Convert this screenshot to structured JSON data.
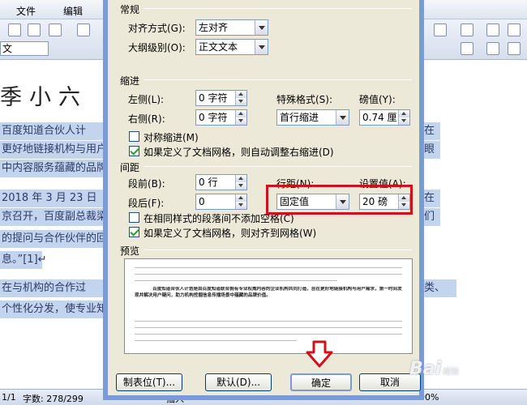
{
  "word": {
    "menus": [
      "文件",
      "编辑"
    ],
    "style_box": "文",
    "title_left": "季小六",
    "title_right": "季",
    "lines_left": [
      "    百度知道合伙人计",
      "更好地链接机构与用户",
      "中内容服务蕴藏的品牌",
      "    2018 年 3 月 23 日",
      "京召开，百度副总裁梁",
      "的提问与合作伙伴的回",
      "息。”[1]↵",
      "    在与机构的合作过",
      "个性化分发，使专业知"
    ],
    "lines_right": [
      "在",
      "眼",
      "在",
      "们",
      "类、"
    ],
    "status_text": {
      "page": "1/1",
      "words": "字数: 278/299",
      "mode": "插入",
      "zoom": "100%"
    }
  },
  "watermark": {
    "text": "Bai",
    "suffix": "经验"
  },
  "dialog": {
    "general": {
      "section": "常规",
      "alignment_label": "对齐方式(G):",
      "alignment_value": "左对齐",
      "outline_label": "大纲级别(O):",
      "outline_value": "正文文本"
    },
    "indent": {
      "section": "缩进",
      "left_label": "左侧(L):",
      "left_value": "0 字符",
      "right_label": "右侧(R):",
      "right_value": "0 字符",
      "special_label": "特殊格式(S):",
      "special_value": "首行缩进",
      "by_label": "磅值(Y):",
      "by_value": "0.74 厘",
      "mirror_label": "对称缩进(M)",
      "auto_adjust_label": "如果定义了文档网格，则自动调整右缩进(D)",
      "mirror_checked": false,
      "auto_adjust_checked": true
    },
    "spacing": {
      "section": "间距",
      "before_label": "段前(B):",
      "before_value": "0 行",
      "after_label": "段后(F):",
      "after_value": "0",
      "line_spacing_label": "行距(N):",
      "line_spacing_value": "固定值",
      "at_label": "设置值(A):",
      "at_value": "20 磅",
      "no_space_label": "在相同样式的段落间不添加空格(C)",
      "snap_grid_label": "如果定义了文档网格，则对齐到网格(W)",
      "no_space_checked": false,
      "snap_grid_checked": true
    },
    "preview": {
      "section": "预览",
      "sample_text": "百度知道合伙人计划是由百度知道联合拥有专业权威内容的企业机构共同打造，旨在更好地链接机构与用户需求，第一时间发现并解决用户疑问，助力机构挖掘信息传播场景中蕴藏的品牌价值。"
    },
    "buttons": {
      "tabs": "制表位(T)...",
      "default": "默认(D)...",
      "ok": "确定",
      "cancel": "取消"
    }
  },
  "colors": {
    "highlight": "#d0101a",
    "selection": "#c3d4ee",
    "dialog_bg": "#ece9d8"
  }
}
